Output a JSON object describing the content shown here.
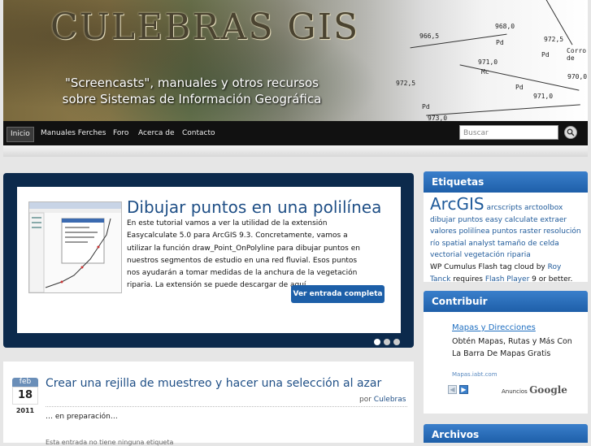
{
  "header": {
    "site_title": "CULEBRAS  GIS",
    "tagline_1": "\"Screencasts\", manuales y otros recursos",
    "tagline_2": "sobre Sistemas de Información Geográfica",
    "map_labels": [
      "968,0",
      "966,5",
      "972,5",
      "Pd",
      "971,0",
      "Mc",
      "Pd",
      "972,5",
      "Pd",
      "971,0",
      "Pd",
      "973,0",
      "Corro de",
      "970,0"
    ]
  },
  "nav": {
    "items": [
      "Inicio",
      "Manuales Ferches",
      "Foro",
      "Acerca de",
      "Contacto"
    ],
    "search_placeholder": "Buscar"
  },
  "slider": {
    "title": "Dibujar puntos en una polilínea",
    "text": "En este tutorial vamos a ver la utilidad de la extensión Easycalculate 5.0 para ArcGIS 9.3. Concretamente, vamos a utilizar la función draw_Point_OnPolyline para dibujar puntos en nuestros segmentos de estudio en una red fluvial. Esos puntos nos ayudarán a tomar medidas de la anchura de la vegetación riparia. La extensión se puede descargar de aquí. …",
    "button": "Ver entrada completa"
  },
  "post": {
    "month": "feb",
    "day": "18",
    "year": "2011",
    "title": "Crear una rejilla de muestreo y hacer una selección al azar",
    "by": "por",
    "author": "Culebras",
    "body": "… en preparación…",
    "footer": "Esta entrada no tiene ninguna etiqueta"
  },
  "sidebar": {
    "etiquetas": {
      "heading": "Etiquetas",
      "big_tag": "ArcGIS",
      "tags_line": "arcscripts arctoolbox dibujar puntos easy calculate extraer valores polilínea puntos raster resolución río spatial analyst tamaño de celda vectorial vegetación riparia",
      "cumulus_1": "WP Cumulus Flash tag cloud by",
      "cumulus_author": "Roy Tanck",
      "cumulus_2": "requires",
      "cumulus_player": "Flash Player",
      "cumulus_3": "9 or better."
    },
    "contribuir": {
      "heading": "Contribuir",
      "ad_title": "Mapas y Direcciones",
      "ad_text": "Obtén Mapas, Rutas y Más Con La Barra De Mapas Gratis",
      "ad_url": "Mapas.iabt.com",
      "ad_label": "Anuncios",
      "ad_brand": "Google"
    },
    "archivos": {
      "heading": "Archivos"
    }
  }
}
